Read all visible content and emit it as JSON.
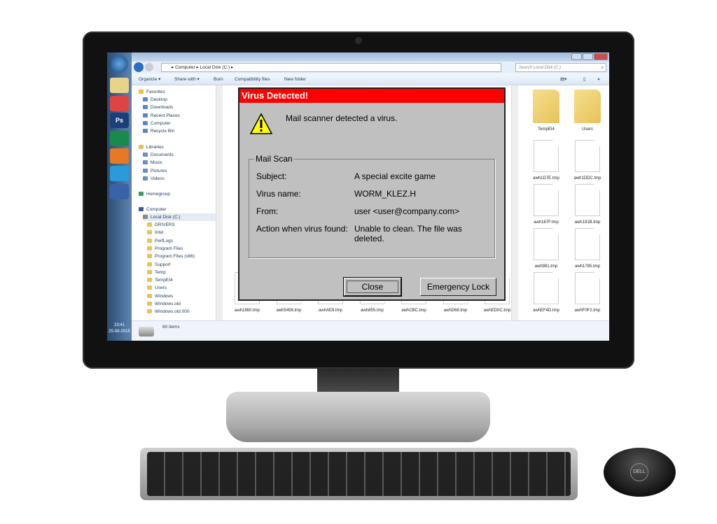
{
  "taskbar": {
    "icons": [
      "windows-start",
      "explorer",
      "chrome",
      "photoshop",
      "ico",
      "firefox",
      "app",
      "word"
    ],
    "time": "23:41",
    "date": "25-08-2015"
  },
  "explorer": {
    "breadcrumb": [
      "Computer",
      "Local Disk (C:)"
    ],
    "search_placeholder": "Search Local Disk (C:)",
    "toolbar": [
      "Organize ▾",
      "Share with ▾",
      "Burn",
      "Compatibility files",
      "New folder"
    ],
    "nav": {
      "favorites": "Favorites",
      "favorites_items": [
        "Desktop",
        "Downloads",
        "Recent Places",
        "Computer",
        "Recycle Bin"
      ],
      "libraries": "Libraries",
      "libraries_items": [
        "Documents",
        "Music",
        "Pictures",
        "Videos"
      ],
      "homegroup": "Homegroup",
      "computer": "Computer",
      "drive": "Local Disk (C:)",
      "folders": [
        "DRIVERS",
        "Intel",
        "PerfLogs",
        "Program Files",
        "Program Files (x86)",
        "Support",
        "Temp",
        "TempEI4",
        "Users",
        "Windows",
        "Windows.old",
        "Windows.old.000"
      ]
    },
    "files": {
      "folders": [
        "TempEI4",
        "Users"
      ],
      "right_grid": [
        "awh1D7E.tmp",
        "awh1DDC.tmp",
        "awh187F.tmp",
        "awh191B.tmp",
        "awh981.tmp",
        "awh1785.tmp",
        "awhEF4D.tmp",
        "awhF0F2.tmp"
      ],
      "bottom_row": [
        "awh1860.tmp",
        "awh5458.tmp",
        "awhAE8.tmp",
        "awh855.tmp",
        "awhCBC.tmp",
        "awhD68.tmp",
        "awhED0C.tmp"
      ]
    },
    "status": "60 items"
  },
  "dialog": {
    "title": "Virus Detected!",
    "message": "Mail scanner detected a virus.",
    "group": "Mail Scan",
    "rows": [
      {
        "label": "Subject:",
        "value": "A special  excite game"
      },
      {
        "label": "Virus name:",
        "value": "WORM_KLEZ.H"
      },
      {
        "label": "From:",
        "value": "user <user@company.com>"
      },
      {
        "label": "Action when virus found:",
        "value": "Unable to clean. The file was deleted."
      }
    ],
    "close": "Close",
    "emergency": "Emergency Lock",
    "colors": {
      "titlebar": "#ff0000",
      "body": "#c0c0c0"
    }
  },
  "hardware": {
    "mouse_logo": "DELL"
  }
}
